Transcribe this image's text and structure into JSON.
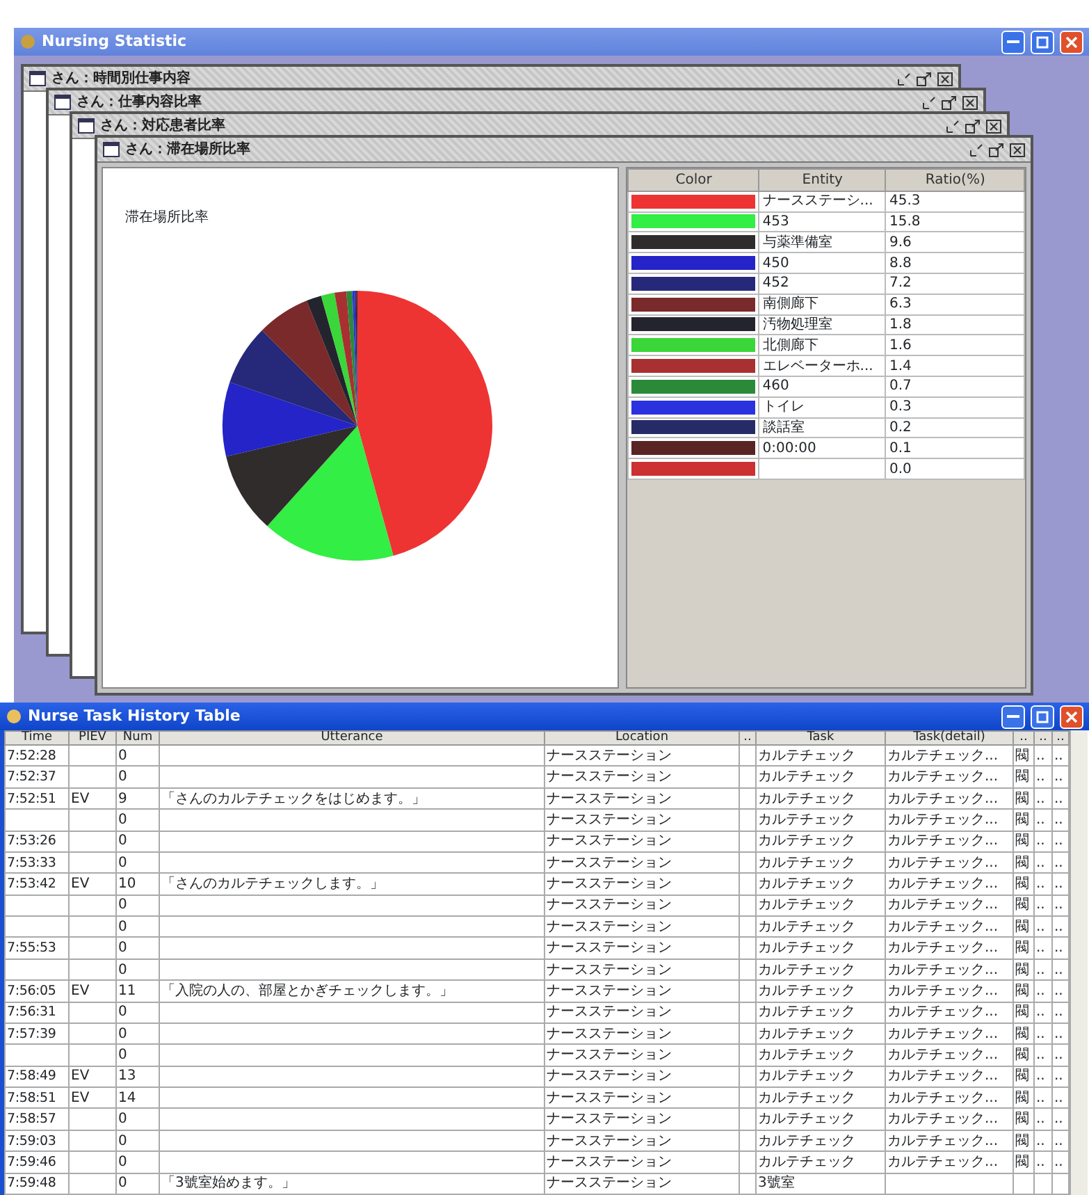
{
  "main_window": {
    "title": "Nursing Statistic"
  },
  "frames": [
    {
      "title": "さん：時間別仕事内容"
    },
    {
      "title": "さん：仕事内容比率"
    },
    {
      "title": "さん：対応患者比率"
    },
    {
      "title": "さん：滞在場所比率",
      "chart_data": {
        "type": "pie",
        "title": "滞在場所比率",
        "values": [
          45.3,
          15.8,
          9.6,
          8.8,
          7.2,
          6.3,
          1.8,
          1.6,
          1.4,
          0.7,
          0.3,
          0.2,
          0.1,
          0.0
        ]
      },
      "legend": {
        "columns": [
          "Color",
          "Entity",
          "Ratio(%)"
        ],
        "rows": [
          {
            "color": "#ee3333",
            "entity": "ナースステーシ...",
            "ratio": "45.3"
          },
          {
            "color": "#33ee44",
            "entity": "453",
            "ratio": "15.8"
          },
          {
            "color": "#302c2c",
            "entity": "与薬準備室",
            "ratio": "9.6"
          },
          {
            "color": "#2424c8",
            "entity": "450",
            "ratio": "8.8"
          },
          {
            "color": "#26287a",
            "entity": "452",
            "ratio": "7.2"
          },
          {
            "color": "#7a2a2a",
            "entity": "南側廊下",
            "ratio": "6.3"
          },
          {
            "color": "#24242e",
            "entity": "汚物処理室",
            "ratio": "1.8"
          },
          {
            "color": "#3ad63a",
            "entity": "北側廊下",
            "ratio": "1.6"
          },
          {
            "color": "#a83030",
            "entity": "エレベーターホ...",
            "ratio": "1.4"
          },
          {
            "color": "#2a8a3a",
            "entity": "460",
            "ratio": "0.7"
          },
          {
            "color": "#2a32e0",
            "entity": "トイレ",
            "ratio": "0.3"
          },
          {
            "color": "#262a66",
            "entity": "談話室",
            "ratio": "0.2"
          },
          {
            "color": "#5a2424",
            "entity": "0:00:00",
            "ratio": "0.1"
          },
          {
            "color": "#cc3030",
            "ratio": "0.0"
          }
        ]
      }
    }
  ],
  "history_window": {
    "title": "Nurse Task History Table",
    "columns": [
      "Time",
      "PIEV",
      "Num",
      "Utterance",
      "Location",
      "..",
      "Task",
      "Task(detail)",
      "..",
      "..",
      ".."
    ],
    "rows": [
      {
        "time": "7:52:28",
        "num": "0",
        "location": "ナースステーション",
        "task": "カルテチェック",
        "task_detail": "カルテチェック...",
        "column_9": "閥",
        "column_10": "..",
        "column_11": ".."
      },
      {
        "time": "7:52:37",
        "num": "0",
        "location": "ナースステーション",
        "task": "カルテチェック",
        "task_detail": "カルテチェック...",
        "column_9": "閥",
        "column_10": "..",
        "column_11": ".."
      },
      {
        "time": "7:52:51",
        "piev": "EV",
        "num": "9",
        "utterance": "「さんのカルテチェックをはじめます。」",
        "location": "ナースステーション",
        "task": "カルテチェック",
        "task_detail": "カルテチェック...",
        "column_9": "閥",
        "column_10": "..",
        "column_11": ".."
      },
      {
        "num": "0",
        "location": "ナースステーション",
        "task": "カルテチェック",
        "task_detail": "カルテチェック...",
        "column_9": "閥",
        "column_10": "..",
        "column_11": ".."
      },
      {
        "time": "7:53:26",
        "num": "0",
        "location": "ナースステーション",
        "task": "カルテチェック",
        "task_detail": "カルテチェック...",
        "column_9": "閥",
        "column_10": "..",
        "column_11": ".."
      },
      {
        "time": "7:53:33",
        "num": "0",
        "location": "ナースステーション",
        "task": "カルテチェック",
        "task_detail": "カルテチェック...",
        "column_9": "閥",
        "column_10": "..",
        "column_11": ".."
      },
      {
        "time": "7:53:42",
        "piev": "EV",
        "num": "10",
        "utterance": "「さんのカルテチェックします。」",
        "location": "ナースステーション",
        "task": "カルテチェック",
        "task_detail": "カルテチェック...",
        "column_9": "閥",
        "column_10": "..",
        "column_11": ".."
      },
      {
        "num": "0",
        "location": "ナースステーション",
        "task": "カルテチェック",
        "task_detail": "カルテチェック...",
        "column_9": "閥",
        "column_10": "..",
        "column_11": ".."
      },
      {
        "num": "0",
        "location": "ナースステーション",
        "task": "カルテチェック",
        "task_detail": "カルテチェック...",
        "column_9": "閥",
        "column_10": "..",
        "column_11": ".."
      },
      {
        "time": "7:55:53",
        "num": "0",
        "location": "ナースステーション",
        "task": "カルテチェック",
        "task_detail": "カルテチェック...",
        "column_9": "閥",
        "column_10": "..",
        "column_11": ".."
      },
      {
        "num": "0",
        "location": "ナースステーション",
        "task": "カルテチェック",
        "task_detail": "カルテチェック...",
        "column_9": "閥",
        "column_10": "..",
        "column_11": ".."
      },
      {
        "time": "7:56:05",
        "piev": "EV",
        "num": "11",
        "utterance": "「入院の人の、部屋とかぎチェックします。」",
        "location": "ナースステーション",
        "task": "カルテチェック",
        "task_detail": "カルテチェック...",
        "column_9": "閥",
        "column_10": "..",
        "column_11": ".."
      },
      {
        "time": "7:56:31",
        "num": "0",
        "location": "ナースステーション",
        "task": "カルテチェック",
        "task_detail": "カルテチェック...",
        "column_9": "閥",
        "column_10": "..",
        "column_11": ".."
      },
      {
        "time": "7:57:39",
        "num": "0",
        "location": "ナースステーション",
        "task": "カルテチェック",
        "task_detail": "カルテチェック...",
        "column_9": "閥",
        "column_10": "..",
        "column_11": ".."
      },
      {
        "num": "0",
        "location": "ナースステーション",
        "task": "カルテチェック",
        "task_detail": "カルテチェック...",
        "column_9": "閥",
        "column_10": "..",
        "column_11": ".."
      },
      {
        "time": "7:58:49",
        "piev": "EV",
        "num": "13",
        "location": "ナースステーション",
        "task": "カルテチェック",
        "task_detail": "カルテチェック...",
        "column_9": "閥",
        "column_10": "..",
        "column_11": ".."
      },
      {
        "time": "7:58:51",
        "piev": "EV",
        "num": "14",
        "location": "ナースステーション",
        "task": "カルテチェック",
        "task_detail": "カルテチェック...",
        "column_9": "閥",
        "column_10": "..",
        "column_11": ".."
      },
      {
        "time": "7:58:57",
        "num": "0",
        "location": "ナースステーション",
        "task": "カルテチェック",
        "task_detail": "カルテチェック...",
        "column_9": "閥",
        "column_10": "..",
        "column_11": ".."
      },
      {
        "time": "7:59:03",
        "num": "0",
        "location": "ナースステーション",
        "task": "カルテチェック",
        "task_detail": "カルテチェック...",
        "column_9": "閥",
        "column_10": "..",
        "column_11": ".."
      },
      {
        "time": "7:59:46",
        "num": "0",
        "location": "ナースステーション",
        "task": "カルテチェック",
        "task_detail": "カルテチェック...",
        "column_9": "閥",
        "column_10": "..",
        "column_11": ".."
      },
      {
        "time": "7:59:48",
        "num": "0",
        "utterance": "「3號室始めます。」",
        "location": "ナースステーション",
        "task": "3號室"
      }
    ]
  }
}
